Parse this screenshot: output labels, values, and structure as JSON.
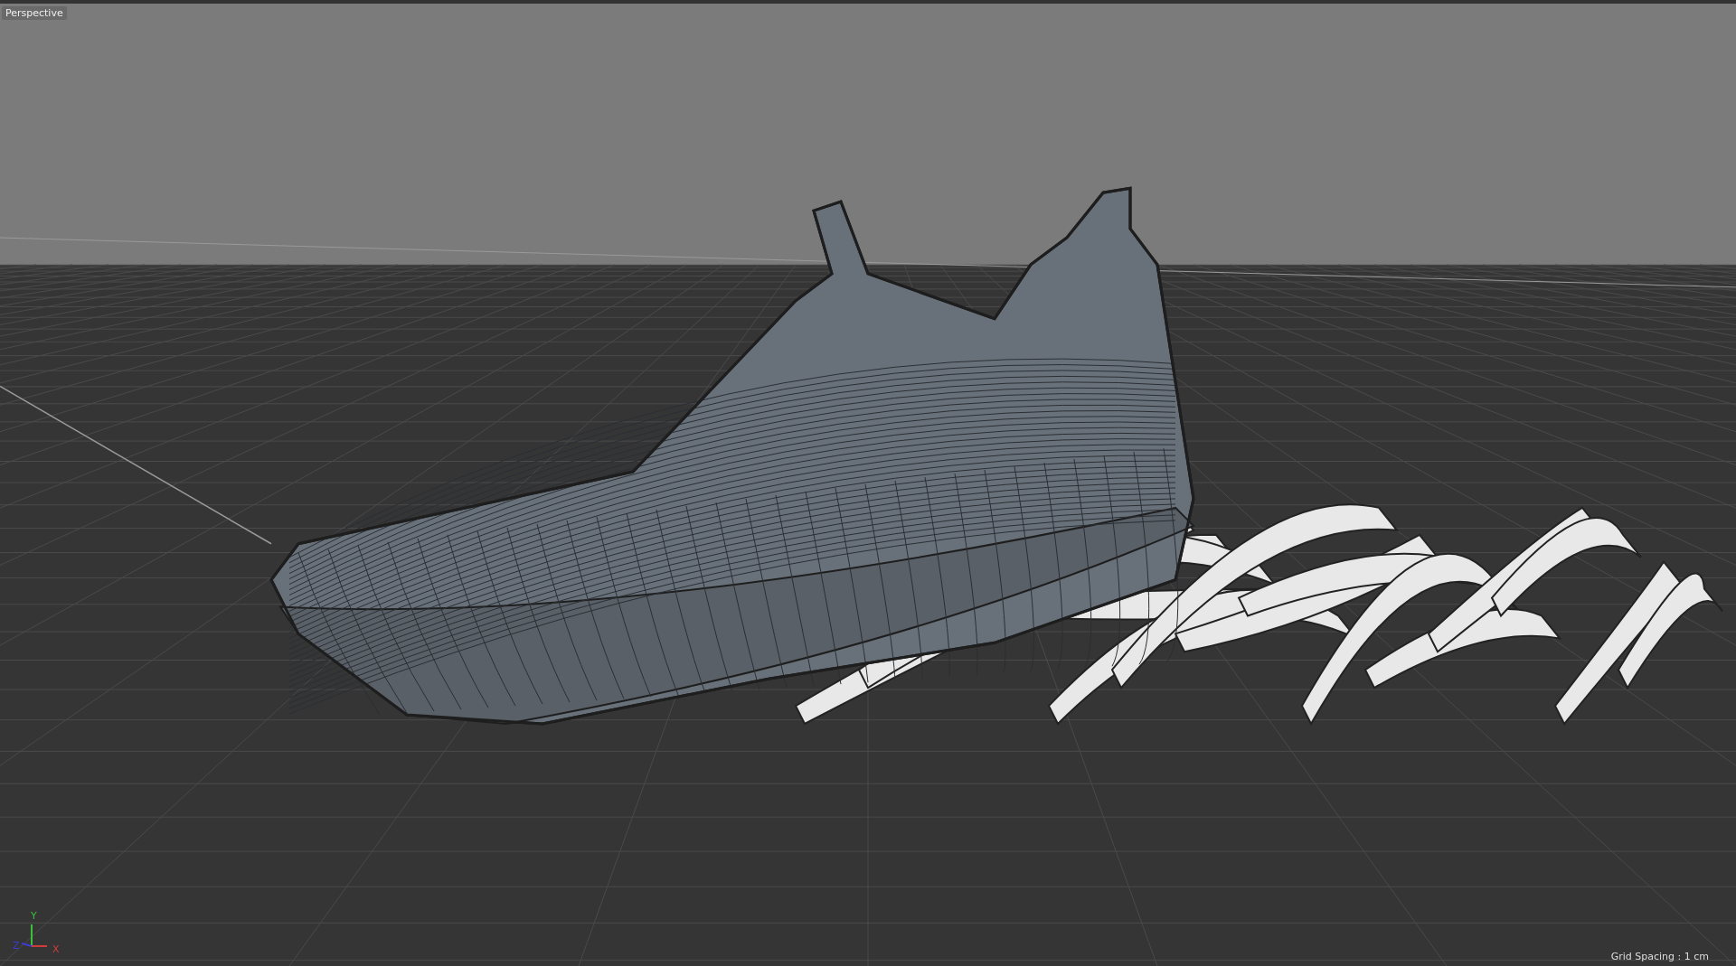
{
  "viewport": {
    "label": "Perspective",
    "grid_spacing": "Grid Spacing : 1 cm",
    "axes": [
      {
        "kind": "y",
        "label": "Y"
      },
      {
        "kind": "z",
        "label": "Z"
      },
      {
        "kind": "x",
        "label": "X"
      }
    ]
  }
}
